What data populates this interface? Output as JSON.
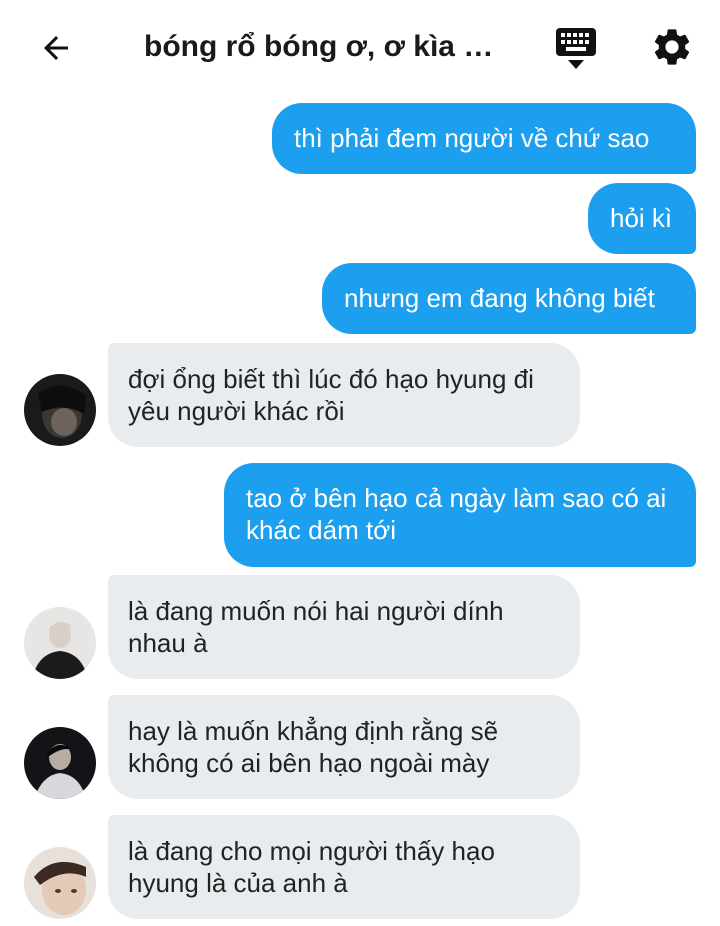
{
  "header": {
    "title": "bóng rổ bóng ơ, ơ kìa b...",
    "back_icon": "arrow-left-icon",
    "keyboard_icon": "keyboard-icon",
    "settings_icon": "gear-icon"
  },
  "colors": {
    "outgoing_bubble": "#1d9ff0",
    "incoming_bubble": "#e9ecef",
    "text_dark": "#1f1f1f"
  },
  "messages": [
    {
      "from": "me",
      "text": "thì phải đem người về chứ sao"
    },
    {
      "from": "me",
      "text": "hỏi kì"
    },
    {
      "from": "me",
      "text": "nhưng em đang không biết"
    },
    {
      "from": "other",
      "text": "đợi ổng biết thì lúc đó hạo hyung đi yêu người khác rồi"
    },
    {
      "from": "me",
      "text": "tao ở bên hạo cả ngày làm sao có ai khác dám tới"
    },
    {
      "from": "other",
      "text": "là đang muốn nói hai người dính nhau à"
    },
    {
      "from": "other",
      "text": "hay là muốn khẳng định rằng sẽ không có ai bên hạo ngoài mày"
    },
    {
      "from": "other",
      "text": "là đang cho mọi người thấy hạo hyung là của anh à"
    }
  ]
}
